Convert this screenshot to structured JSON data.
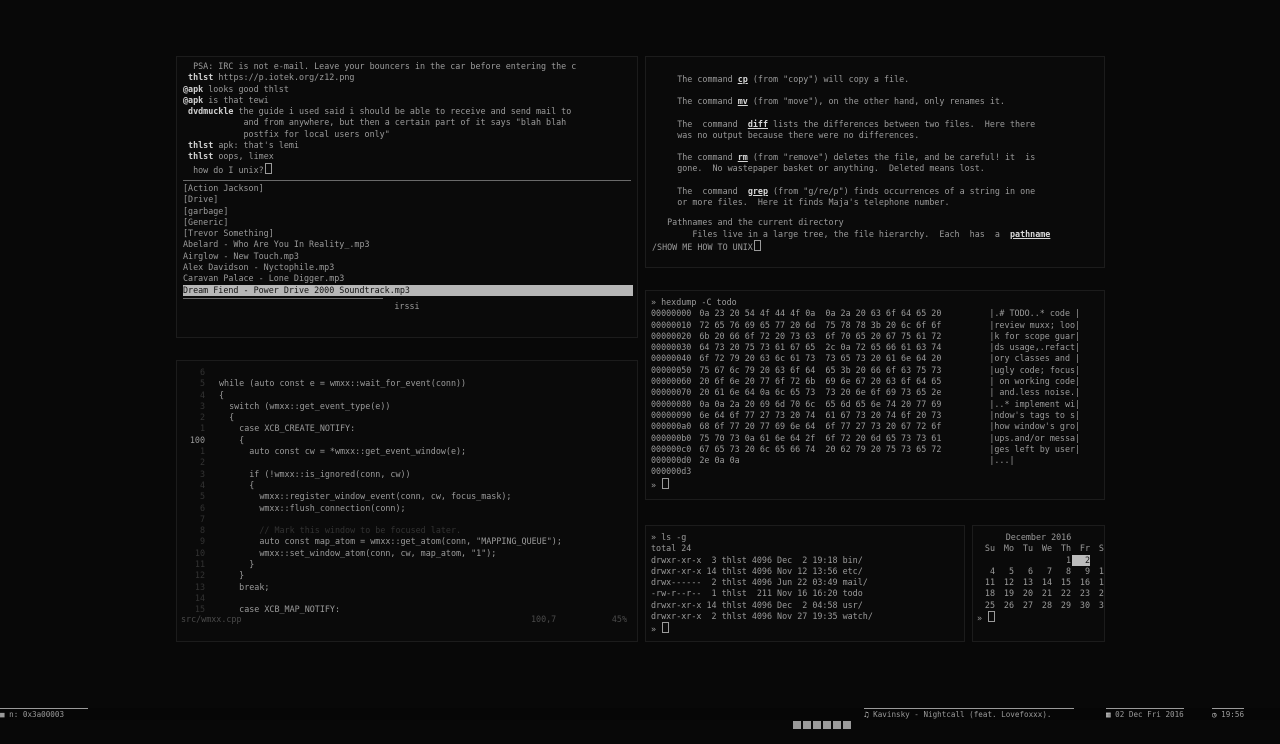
{
  "irc": {
    "messages": [
      {
        "nick": "",
        "text": "PSA: IRC is not e-mail. Leave your bouncers in the car before entering the c"
      },
      {
        "nick": "thlst",
        "text": "https://p.iotek.org/z12.png"
      },
      {
        "nick": "@apk",
        "text": "looks good thlst"
      },
      {
        "nick": "@apk",
        "text": "is that tewi"
      },
      {
        "nick": "dvdmuckle",
        "text": "the guide i used said i should be able to receive and send mail to"
      },
      {
        "nick": "",
        "text": "and from anywhere, but then a certain part of it says \"blah blah"
      },
      {
        "nick": "",
        "text": "postfix for local users only\""
      },
      {
        "nick": "thlst",
        "text": "apk: that's lemi"
      },
      {
        "nick": "thlst",
        "text": "oops, limex"
      }
    ],
    "input": "how do I unix?",
    "folders": [
      "[Action Jackson]",
      "[Drive]",
      "[garbage]",
      "[Generic]",
      "[Trevor Something]"
    ],
    "files": [
      "Abelard - Who Are You In Reality_.mp3",
      "Airglow - New Touch.mp3",
      "Alex Davidson - Nyctophile.mp3",
      "Caravan Palace - Lone Digger.mp3"
    ],
    "selected_file": "Dream Fiend - Power Drive 2000 Soundtrack.mp3",
    "status": "irssi"
  },
  "man": {
    "lines": [
      {
        "pre": "The command ",
        "cmd": "cp",
        "post": " (from \"copy\") will copy a file."
      },
      {
        "pre": "The command ",
        "cmd": "mv",
        "post": " (from \"move\"), on the other hand, only renames it."
      },
      {
        "pre": "The  command  ",
        "cmd": "diff",
        "post": " lists the differences between two files.  Here there"
      },
      {
        "pre": "",
        "cmd": "",
        "post": "was no output because there were no differences."
      },
      {
        "pre": "The command ",
        "cmd": "rm",
        "post": " (from \"remove\") deletes the file, and be careful! it  is"
      },
      {
        "pre": "",
        "cmd": "",
        "post": "gone.  No wastepaper basket or anything.  Deleted means lost."
      },
      {
        "pre": "The  command  ",
        "cmd": "grep",
        "post": " (from \"g/re/p\") finds occurrences of a string in one"
      },
      {
        "pre": "",
        "cmd": "",
        "post": "or more files.  Here it finds Maja's telephone number."
      }
    ],
    "section": "Pathnames and the current directory",
    "section_text": "Files live in a large tree, the file hierarchy.  Each  has  a  ",
    "section_link": "pathname",
    "search": "/SHOW ME HOW TO UNIX"
  },
  "code": {
    "lines": [
      {
        "n": "6",
        "t": ""
      },
      {
        "n": "5",
        "t": "while (auto const e = wmxx::wait_for_event(conn))"
      },
      {
        "n": "4",
        "t": "{"
      },
      {
        "n": "3",
        "t": "  switch (wmxx::get_event_type(e))"
      },
      {
        "n": "2",
        "t": "  {"
      },
      {
        "n": "1",
        "t": "    case XCB_CREATE_NOTIFY:"
      },
      {
        "n": "100",
        "t": "    {",
        "cur": true
      },
      {
        "n": "1",
        "t": "      auto const cw = *wmxx::get_event_window(e);"
      },
      {
        "n": "2",
        "t": ""
      },
      {
        "n": "3",
        "t": "      if (!wmxx::is_ignored(conn, cw))"
      },
      {
        "n": "4",
        "t": "      {"
      },
      {
        "n": "5",
        "t": "        wmxx::register_window_event(conn, cw, focus_mask);"
      },
      {
        "n": "6",
        "t": "        wmxx::flush_connection(conn);"
      },
      {
        "n": "7",
        "t": ""
      },
      {
        "n": "8",
        "t": "        // Mark this window to be focused later.",
        "com": true
      },
      {
        "n": "9",
        "t": "        auto const map_atom = wmxx::get_atom(conn, \"MAPPING_QUEUE\");"
      },
      {
        "n": "10",
        "t": "        wmxx::set_window_atom(conn, cw, map_atom, \"1\");"
      },
      {
        "n": "11",
        "t": "      }"
      },
      {
        "n": "12",
        "t": "    }"
      },
      {
        "n": "13",
        "t": "    break;"
      },
      {
        "n": "14",
        "t": ""
      },
      {
        "n": "15",
        "t": "    case XCB_MAP_NOTIFY:"
      }
    ],
    "status_file": "src/wmxx.cpp",
    "status_pos": "100,7",
    "status_pct": "45%"
  },
  "hexdump": {
    "command": "» hexdump -C todo",
    "rows": [
      {
        "o": "00000000",
        "h": "0a 23 20 54 4f 44 4f 0a  0a 2a 20 63 6f 64 65 20",
        "a": "|.# TODO..* code |"
      },
      {
        "o": "00000010",
        "h": "72 65 76 69 65 77 20 6d  75 78 78 3b 20 6c 6f 6f",
        "a": "|review muxx; loo|"
      },
      {
        "o": "00000020",
        "h": "6b 20 66 6f 72 20 73 63  6f 70 65 20 67 75 61 72",
        "a": "|k for scope guar|"
      },
      {
        "o": "00000030",
        "h": "64 73 20 75 73 61 67 65  2c 0a 72 65 66 61 63 74",
        "a": "|ds usage,.refact|"
      },
      {
        "o": "00000040",
        "h": "6f 72 79 20 63 6c 61 73  73 65 73 20 61 6e 64 20",
        "a": "|ory classes and |"
      },
      {
        "o": "00000050",
        "h": "75 67 6c 79 20 63 6f 64  65 3b 20 66 6f 63 75 73",
        "a": "|ugly code; focus|"
      },
      {
        "o": "00000060",
        "h": "20 6f 6e 20 77 6f 72 6b  69 6e 67 20 63 6f 64 65",
        "a": "| on working code|"
      },
      {
        "o": "00000070",
        "h": "20 61 6e 64 0a 6c 65 73  73 20 6e 6f 69 73 65 2e",
        "a": "| and.less noise.|"
      },
      {
        "o": "00000080",
        "h": "0a 0a 2a 20 69 6d 70 6c  65 6d 65 6e 74 20 77 69",
        "a": "|..* implement wi|"
      },
      {
        "o": "00000090",
        "h": "6e 64 6f 77 27 73 20 74  61 67 73 20 74 6f 20 73",
        "a": "|ndow's tags to s|"
      },
      {
        "o": "000000a0",
        "h": "68 6f 77 20 77 69 6e 64  6f 77 27 73 20 67 72 6f",
        "a": "|how window's gro|"
      },
      {
        "o": "000000b0",
        "h": "75 70 73 0a 61 6e 64 2f  6f 72 20 6d 65 73 73 61",
        "a": "|ups.and/or messa|"
      },
      {
        "o": "000000c0",
        "h": "67 65 73 20 6c 65 66 74  20 62 79 20 75 73 65 72",
        "a": "|ges left by user|"
      },
      {
        "o": "000000d0",
        "h": "2e 0a 0a",
        "a": "|...|"
      },
      {
        "o": "000000d3",
        "h": "",
        "a": ""
      }
    ],
    "prompt": "»"
  },
  "ls": {
    "command": "» ls -g",
    "total": "total 24",
    "rows": [
      "drwxr-xr-x  3 thlst 4096 Dec  2 19:18 bin/",
      "drwxr-xr-x 14 thlst 4096 Nov 12 13:56 etc/",
      "drwx------  2 thlst 4096 Jun 22 03:49 mail/",
      "-rw-r--r--  1 thlst  211 Nov 16 16:20 todo",
      "drwxr-xr-x 14 thlst 4096 Dec  2 04:58 usr/",
      "drwxr-xr-x  2 thlst 4096 Nov 27 19:35 watch/"
    ],
    "prompt": "»"
  },
  "calendar": {
    "title": "December 2016",
    "days": [
      "Su",
      "Mo",
      "Tu",
      "We",
      "Th",
      "Fr",
      "Sa"
    ],
    "weeks": [
      [
        "",
        "",
        "",
        "",
        "1",
        "2",
        "3"
      ],
      [
        "4",
        "5",
        "6",
        "7",
        "8",
        "9",
        "10"
      ],
      [
        "11",
        "12",
        "13",
        "14",
        "15",
        "16",
        "17"
      ],
      [
        "18",
        "19",
        "20",
        "21",
        "22",
        "23",
        "24"
      ],
      [
        "25",
        "26",
        "27",
        "28",
        "29",
        "30",
        "31"
      ]
    ],
    "today": "2",
    "prompt": "»"
  },
  "statusbar": {
    "window": "n: 0x3a00003",
    "song": "Kavinsky - Nightcall (feat. Lovefoxxx).",
    "date": "02 Dec Fri 2016",
    "time": "19:56"
  },
  "colors": {
    "background": "#080808",
    "text": "#9a9a9a",
    "highlight": "#b7b7b7"
  }
}
